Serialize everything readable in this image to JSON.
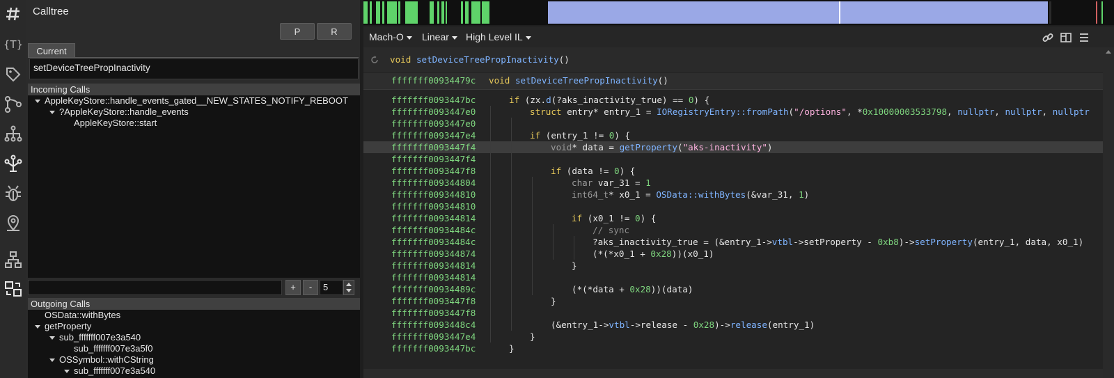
{
  "sidebar": {
    "icons": [
      "hash-icon",
      "types-icon",
      "tag-icon",
      "graph-icon",
      "hierarchy-icon",
      "calltree-icon",
      "bug-icon",
      "location-pin-icon",
      "stack-icon",
      "compare-icon"
    ]
  },
  "calltree": {
    "title": "Calltree",
    "btn_p": "P",
    "btn_r": "R",
    "tab_current": "Current",
    "current_function": "setDeviceTreePropInactivity",
    "incoming_header": "Incoming Calls",
    "incoming": [
      {
        "label": "AppleKeyStore::handle_events_gated__NEW_STATES_NOTIFY_REBOOT",
        "depth": 0,
        "expanded": true
      },
      {
        "label": "?AppleKeyStore::handle_events",
        "depth": 1,
        "expanded": true
      },
      {
        "label": "AppleKeyStore::start",
        "depth": 2,
        "expanded": false
      }
    ],
    "depth_plus": "+",
    "depth_minus": "-",
    "depth_value": "5",
    "outgoing_header": "Outgoing Calls",
    "outgoing": [
      {
        "label": "OSData::withBytes",
        "depth": 0,
        "expanded": false
      },
      {
        "label": "getProperty",
        "depth": 0,
        "expanded": true
      },
      {
        "label": "sub_fffffff007e3a540",
        "depth": 1,
        "expanded": true
      },
      {
        "label": "sub_fffffff007e3a5f0",
        "depth": 2,
        "expanded": false
      },
      {
        "label": "OSSymbol::withCString",
        "depth": 1,
        "expanded": true
      },
      {
        "label": "sub_fffffff007e3a540",
        "depth": 2,
        "expanded": true
      }
    ]
  },
  "toolbar": {
    "view_type": "Mach-O",
    "view_mode": "Linear",
    "il_level": "High Level IL"
  },
  "editor": {
    "signature": "void setDeviceTreePropInactivity()",
    "header_addr": "fffffff00934479c",
    "header_sig": "void setDeviceTreePropInactivity()",
    "lines": [
      {
        "addr": "fffffff0093447bc",
        "code": "if (zx.d(?aks_inactivity_true) == 0) {"
      },
      {
        "addr": "fffffff0093447e0",
        "code": "struct entry* entry_1 = IORegistryEntry::fromPath(\"/options\", *0x10000003533798, nullptr, nullptr, nullptr"
      },
      {
        "addr": "fffffff0093447e0",
        "code": ""
      },
      {
        "addr": "fffffff0093447e4",
        "code": "if (entry_1 != 0) {"
      },
      {
        "addr": "fffffff0093447f4",
        "code": "void* data = getProperty(\"aks-inactivity\")"
      },
      {
        "addr": "fffffff0093447f4",
        "code": ""
      },
      {
        "addr": "fffffff0093447f8",
        "code": "if (data != 0) {"
      },
      {
        "addr": "fffffff009344804",
        "code": "char var_31 = 1"
      },
      {
        "addr": "fffffff009344810",
        "code": "int64_t* x0_1 = OSData::withBytes(&var_31, 1)"
      },
      {
        "addr": "fffffff009344810",
        "code": ""
      },
      {
        "addr": "fffffff009344814",
        "code": "if (x0_1 != 0) {"
      },
      {
        "addr": "fffffff00934484c",
        "code": "// sync"
      },
      {
        "addr": "fffffff00934484c",
        "code": "?aks_inactivity_true = (&entry_1->vtbl->setProperty - 0xb8)->setProperty(entry_1, data, x0_1)"
      },
      {
        "addr": "fffffff009344874",
        "code": "(*(*x0_1 + 0x28))(x0_1)"
      },
      {
        "addr": "fffffff009344814",
        "code": "}"
      },
      {
        "addr": "fffffff009344814",
        "code": ""
      },
      {
        "addr": "fffffff00934489c",
        "code": "(*(*data + 0x28))(data)"
      },
      {
        "addr": "fffffff0093447f8",
        "code": "}"
      },
      {
        "addr": "fffffff0093447f8",
        "code": ""
      },
      {
        "addr": "fffffff0093448c4",
        "code": "(&entry_1->vtbl->release - 0x28)->release(entry_1)"
      },
      {
        "addr": "fffffff0093447e4",
        "code": "}"
      },
      {
        "addr": "fffffff0093447bc",
        "code": "}"
      }
    ]
  },
  "colors": {
    "address": "#7fd67f",
    "keyword": "#e6c85a",
    "function": "#7fb4ff",
    "string": "#ffb3e0",
    "minimap_green": "#5fd36a",
    "minimap_blue": "#9aa8e6"
  }
}
